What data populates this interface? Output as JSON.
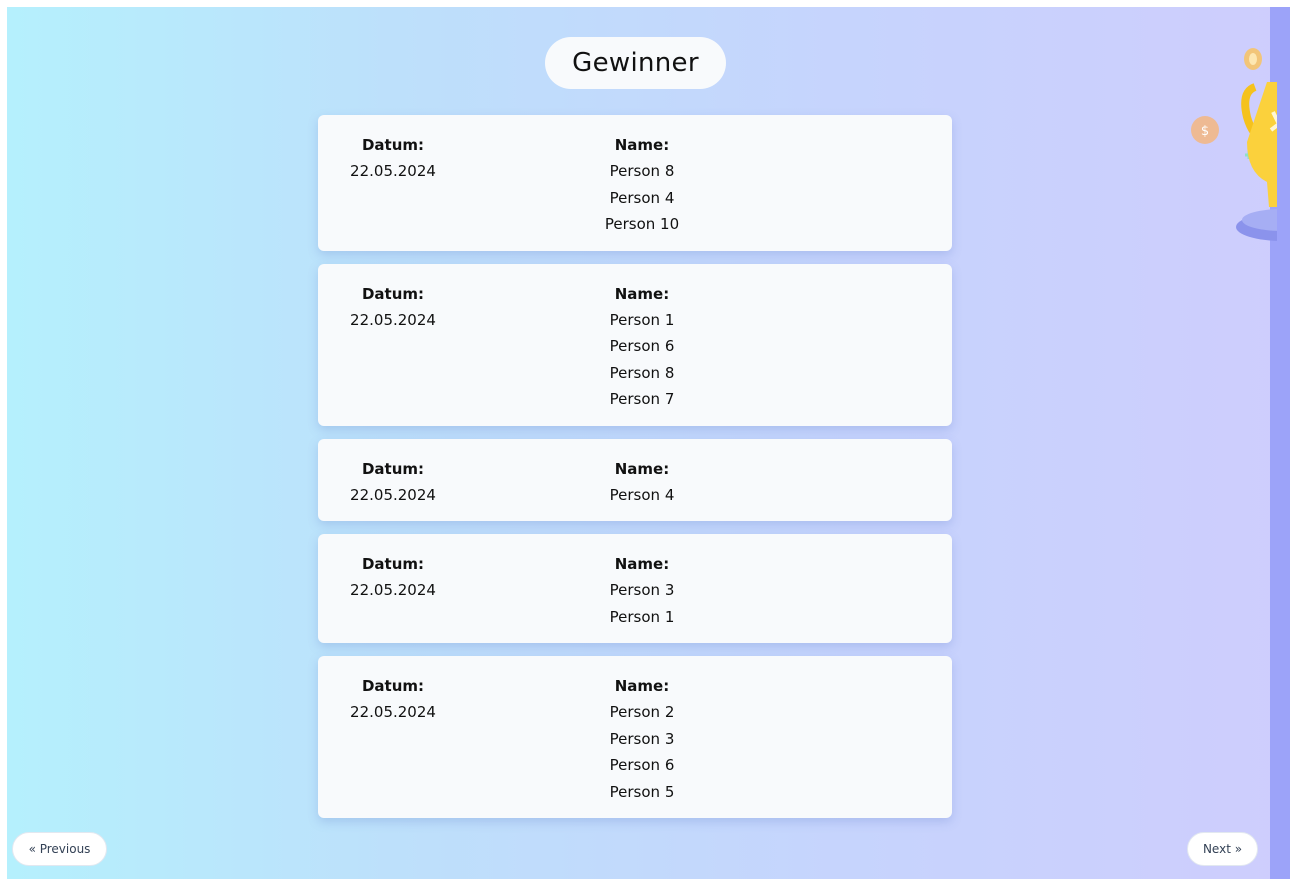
{
  "title": "Gewinner",
  "cards": [
    {
      "date_label": "Datum:",
      "date": "22.05.2024",
      "names_label": "Name:",
      "names": [
        "Person 8",
        "Person 4",
        "Person 10"
      ]
    },
    {
      "date_label": "Datum:",
      "date": "22.05.2024",
      "names_label": "Name:",
      "names": [
        "Person 1",
        "Person 6",
        "Person 8",
        "Person 7"
      ]
    },
    {
      "date_label": "Datum:",
      "date": "22.05.2024",
      "names_label": "Name:",
      "names": [
        "Person 4"
      ]
    },
    {
      "date_label": "Datum:",
      "date": "22.05.2024",
      "names_label": "Name:",
      "names": [
        "Person 3",
        "Person 1"
      ]
    },
    {
      "date_label": "Datum:",
      "date": "22.05.2024",
      "names_label": "Name:",
      "names": [
        "Person 2",
        "Person 3",
        "Person 6",
        "Person 5"
      ]
    }
  ],
  "pagination": {
    "prev_label": "« Previous",
    "next_label": "Next »"
  },
  "decoration": {
    "icon": "trophy-icon"
  },
  "colors": {
    "accent_stripe": "#9ca3f9",
    "card_bg": "#f8fafc"
  }
}
